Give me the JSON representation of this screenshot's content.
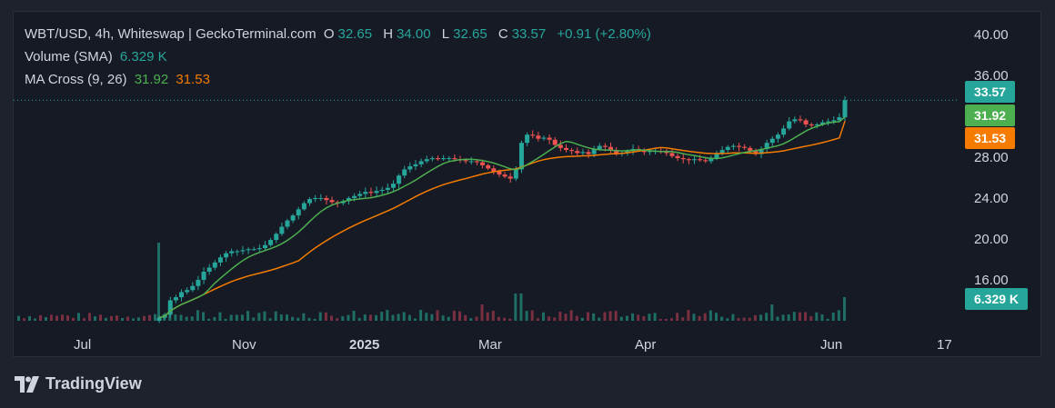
{
  "legend": {
    "symbol_line": "WBT/USD, 4h, Whiteswap | GeckoTerminal.com",
    "open_label": "O",
    "open": "32.65",
    "high_label": "H",
    "high": "34.00",
    "low_label": "L",
    "low": "32.65",
    "close_label": "C",
    "close": "33.57",
    "change": "+0.91 (+2.80%)",
    "volume_label": "Volume (SMA)",
    "volume_value": "6.329 K",
    "ma_label": "MA Cross (9, 26)",
    "ma_fast": "31.92",
    "ma_slow": "31.53"
  },
  "badges": {
    "last_price": "33.57",
    "ma_fast": "31.92",
    "ma_slow": "31.53",
    "volume": "6.329 K"
  },
  "branding": {
    "name": "TradingView"
  },
  "colors": {
    "up": "#26a69a",
    "down": "#ef5350",
    "ma_fast": "#4caf50",
    "ma_slow": "#f57c00",
    "vol_up": "#1f6e66",
    "vol_down": "#7a3040",
    "background": "#161a25",
    "text": "#d1d4dc"
  },
  "chart_data": {
    "type": "candlestick",
    "y_axis": {
      "ticks": [
        16,
        20,
        24,
        28,
        32,
        36,
        40
      ],
      "tick_labels": [
        "16.00",
        "20.00",
        "24.00",
        "28.00",
        "32.00",
        "36.00",
        "40.00"
      ],
      "range": [
        12,
        41.5
      ],
      "position": "right"
    },
    "x_axis": {
      "tick_labels": [
        "Jul",
        "Nov",
        "2025",
        "Mar",
        "Apr",
        "Jun",
        "17"
      ]
    },
    "grid": false,
    "last_price": 33.57,
    "ohlc_last": {
      "open": 32.65,
      "high": 34.0,
      "low": 32.65,
      "close": 33.57,
      "change": 0.91,
      "change_pct": 2.8
    },
    "ma_fast_last": 31.92,
    "ma_slow_last": 31.53,
    "close_series": [
      12.3,
      12.6,
      14.0,
      14.3,
      14.8,
      15.0,
      15.4,
      16.0,
      16.8,
      17.2,
      17.7,
      18.2,
      18.6,
      18.8,
      18.8,
      18.9,
      19.0,
      19.0,
      19.1,
      19.4,
      19.9,
      20.5,
      21.2,
      21.8,
      22.3,
      22.9,
      23.5,
      23.9,
      24.0,
      24.0,
      23.8,
      23.6,
      23.5,
      23.7,
      24.0,
      24.2,
      24.4,
      24.6,
      24.5,
      24.7,
      24.8,
      25.0,
      25.4,
      26.2,
      26.8,
      27.1,
      27.3,
      27.6,
      27.8,
      27.9,
      27.8,
      27.9,
      27.9,
      27.8,
      27.7,
      27.6,
      27.6,
      27.5,
      27.2,
      26.9,
      26.6,
      26.3,
      26.1,
      25.9,
      26.8,
      29.4,
      30.2,
      30.1,
      29.8,
      29.9,
      29.7,
      29.2,
      28.9,
      28.7,
      28.6,
      28.4,
      28.5,
      28.3,
      28.8,
      29.1,
      29.0,
      28.7,
      28.3,
      28.4,
      28.6,
      28.8,
      28.7,
      28.5,
      28.6,
      28.6,
      28.5,
      28.4,
      28.1,
      27.9,
      27.8,
      27.7,
      27.8,
      27.7,
      27.6,
      27.9,
      28.3,
      28.7,
      29.0,
      29.1,
      29.0,
      28.9,
      28.6,
      28.3,
      28.8,
      29.4,
      29.8,
      30.2,
      30.8,
      31.5,
      31.7,
      31.6,
      31.2,
      31.1,
      31.2,
      31.4,
      31.5,
      31.6,
      31.9,
      33.57
    ],
    "volume_last_k": 6.329
  }
}
